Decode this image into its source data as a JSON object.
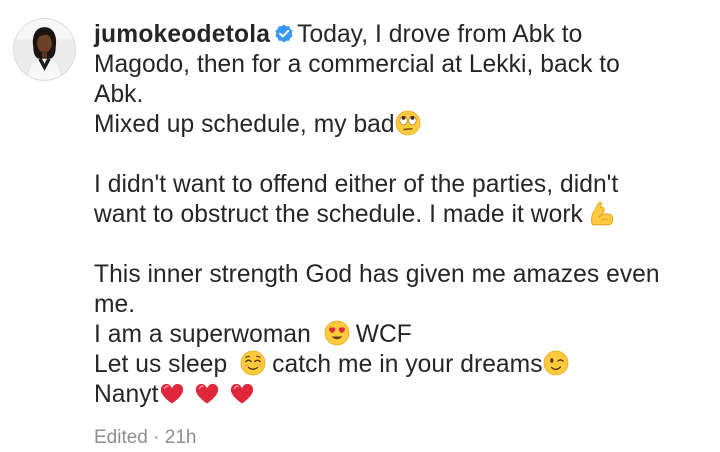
{
  "post": {
    "username": "jumokeodetola",
    "verified": true,
    "caption_lines": [
      "Today, I drove from Abk to",
      "Magodo, then for a commercial  at Lekki, back to",
      "Abk.",
      "Mixed up schedule, my bad",
      "I didn't want to offend either of the parties, didn't",
      "want to obstruct the schedule. I  made it work",
      "This inner strength God has given me amazes even",
      "me.",
      "I am a superwoman",
      "WCF",
      "Let us sleep",
      "catch me in your dreams",
      "Nanyt"
    ],
    "meta": {
      "edited": "Edited",
      "separator": "·",
      "age": "21h"
    }
  },
  "icons": {
    "verified_badge": "verified-badge-icon",
    "emoji_eye_roll": "face-with-rolling-eyes-icon",
    "emoji_flexed_biceps": "flexed-biceps-icon",
    "emoji_heart_eyes": "smiling-face-with-heart-eyes-icon",
    "emoji_relieved": "smiling-face-icon",
    "emoji_wink": "winking-face-icon",
    "emoji_heart": "red-heart-icon"
  },
  "colors": {
    "text": "#262626",
    "meta_text": "#8e8e8e",
    "verified_blue": "#3897f0",
    "heart_red": "#e0283c",
    "emoji_yellow": "#ffcb3d"
  }
}
